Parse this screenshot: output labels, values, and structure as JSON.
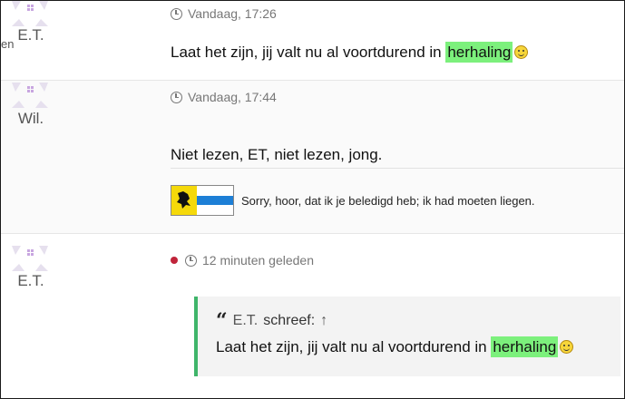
{
  "posts": [
    {
      "author": "E.T.",
      "timestamp": "Vandaag, 17:26",
      "message_prefix": "Laat het zijn, jij valt nu al voortdurend in ",
      "message_highlight": "herhaling",
      "edge_text": "en"
    },
    {
      "author": "Wil.",
      "timestamp": "Vandaag, 17:44",
      "message": "Niet lezen, ET, niet lezen, jong.",
      "signature": "Sorry, hoor, dat ik je beledigd heb; ik had moeten liegen."
    },
    {
      "author": "E.T.",
      "timestamp": "12 minuten geleden",
      "quote": {
        "author": "E.T.",
        "said": "schreef:",
        "arrow": "↑",
        "text_prefix": "Laat het zijn, jij valt nu al voortdurend in ",
        "text_highlight": "herhaling"
      }
    }
  ],
  "colors": {
    "highlight": "#7cf07c",
    "quote_border": "#3fb56a",
    "unread_dot": "#c0243a"
  },
  "icons": [
    "clock-icon",
    "smiley-icon",
    "quote-icon",
    "unread-dot-icon",
    "avatar-icon",
    "flag-icon"
  ]
}
